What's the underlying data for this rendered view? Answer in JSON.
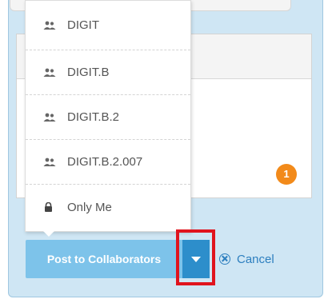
{
  "visibility_menu": {
    "items": [
      {
        "label": "DIGIT",
        "icon": "group-icon"
      },
      {
        "label": "DIGIT.B",
        "icon": "group-icon"
      },
      {
        "label": "DIGIT.B.2",
        "icon": "group-icon"
      },
      {
        "label": "DIGIT.B.2.007",
        "icon": "group-icon"
      },
      {
        "label": "Only Me",
        "icon": "lock-icon"
      }
    ]
  },
  "notification": {
    "count": "1"
  },
  "actions": {
    "post_label": "Post to Collaborators",
    "cancel_label": "Cancel"
  },
  "colors": {
    "panel_bg": "#cfe6f4",
    "post_button": "#7dc3ea",
    "toggle_button": "#2d8ecb",
    "highlight": "#e0141e",
    "badge": "#f28a1a",
    "link": "#2d7fbf"
  }
}
